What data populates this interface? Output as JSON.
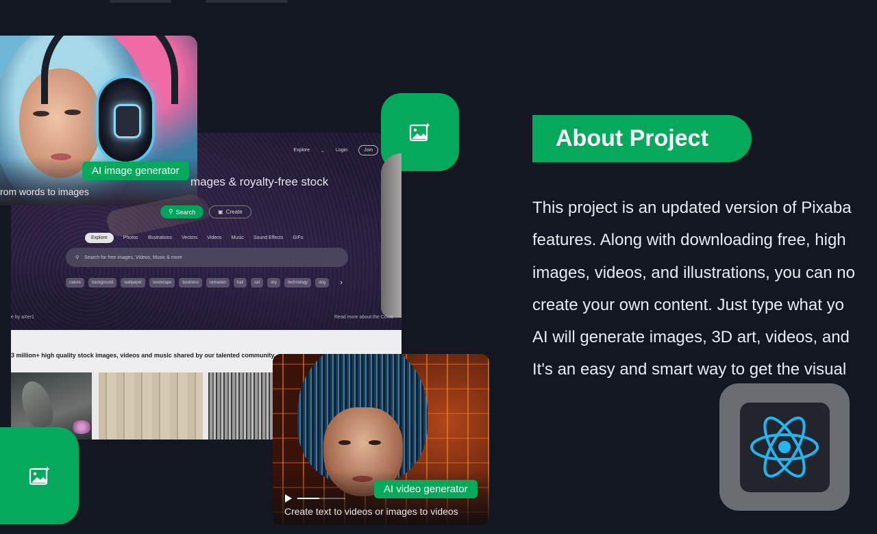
{
  "mockup": {
    "nav": {
      "explore": "Explore",
      "login": "Login",
      "join": "Join"
    },
    "headline": "mages & royalty-free stock",
    "search_button": "Search",
    "create_button": "Create",
    "categories": [
      "Explore",
      "Photos",
      "Illustrations",
      "Vectors",
      "Videos",
      "Music",
      "Sound Effects",
      "GIFs"
    ],
    "search_placeholder": "Search for free images, Videos, Music & more",
    "tags": [
      "nature",
      "background",
      "wallpaper",
      "landscape",
      "business",
      "ramadan",
      "hall",
      "cat",
      "sky",
      "technology",
      "dog"
    ],
    "credit": "e by aXer1",
    "read_more": "Read more about the Conte",
    "tagline": "3 million+ high quality stock images, videos and music shared by our talented community."
  },
  "image_card": {
    "badge": "AI image generator",
    "caption": "rom words to images"
  },
  "video_card": {
    "badge": "AI video generator",
    "caption": "Create text to videos or images to videos",
    "progress": 0.45
  },
  "about": {
    "title": "About Project",
    "lines": [
      "This project is an updated version of Pixaba",
      "features. Along with downloading free, high",
      "images, videos, and illustrations, you can no",
      "create your own content. Just type what yo",
      "AI will generate images, 3D art, videos, and",
      "It's an easy and smart way to get the visual"
    ]
  },
  "icons": {
    "tile_icon": "image-sparkle-icon",
    "tech_badge": "react-logo-icon"
  },
  "colors": {
    "background": "#121722",
    "accent_green": "#05a95b",
    "react_blue": "#1fb6f2"
  }
}
